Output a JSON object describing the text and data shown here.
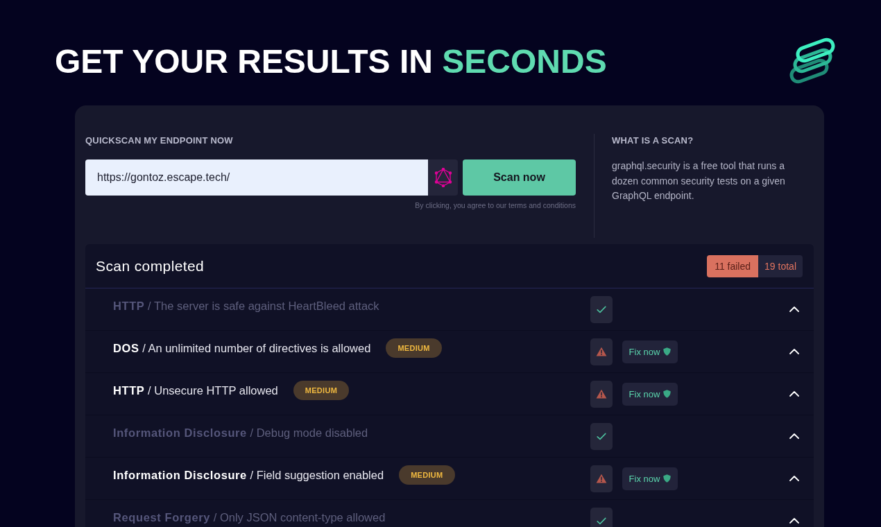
{
  "headline": {
    "text": "GET YOUR RESULTS IN",
    "highlight": "SECONDS"
  },
  "quickscan": {
    "label": "QUICKSCAN MY ENDPOINT NOW",
    "endpoint": "https://gontoz.escape.tech/",
    "button": "Scan now",
    "terms": "By clicking, you agree to our terms and conditions"
  },
  "info": {
    "title": "WHAT IS A SCAN?",
    "text": "graphql.security is a free tool that runs a dozen common security tests on a given GraphQL endpoint."
  },
  "results": {
    "title": "Scan completed",
    "failed": "11 failed",
    "total": "19 total",
    "rows": [
      {
        "check": "**HTTP** / The server is safe against HeartBleed attack",
        "passed": true
      },
      {
        "check": "**DOS** / An unlimited number of directives is allowed",
        "passed": false,
        "severity": "MEDIUM",
        "action": "Fix now"
      },
      {
        "check": "**HTTP** / Unsecure HTTP allowed",
        "passed": false,
        "severity": "MEDIUM",
        "action": "Fix now"
      },
      {
        "check": "**Information Disclosure** / Debug mode disabled",
        "passed": true
      },
      {
        "check": "**Information Disclosure** / Field suggestion enabled",
        "passed": false,
        "severity": "MEDIUM",
        "action": "Fix now"
      },
      {
        "check": "**Request Forgery** / Only JSON content-type allowed",
        "passed": true
      }
    ]
  }
}
